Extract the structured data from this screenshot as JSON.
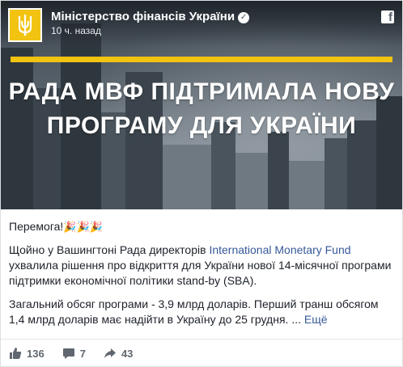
{
  "post": {
    "page_name": "Міністерство фінансів України",
    "timestamp": "10 ч. назад",
    "image_headline_line1": "РАДА МВФ ПІДТРИМАЛА НОВУ",
    "image_headline_line2": "ПРОГРАМУ ДЛЯ УКРАЇНИ",
    "greeting": "Перемога!",
    "greeting_emojis": "🎉🎉🎉",
    "para1_before": "Щойно у Вашингтоні Рада директорів ",
    "para1_link": "International Monetary Fund",
    "para1_after": " ухвалила рішення про відкриття для України нової 14-місячної програми підтримки економічної політики stand-by (SBA).",
    "para2": "Загальний обсяг програми - 3,9 млрд доларів. Перший транш обсягом 1,4 млрд доларів має надійти в Україну до 25 грудня. ... ",
    "see_more": "Ещё"
  },
  "actions": {
    "likes": "136",
    "comments": "7",
    "shares": "43"
  },
  "colors": {
    "brand_yellow": "#f2c311",
    "link_blue": "#365899"
  },
  "icons": [
    "ministry-logo",
    "verified-badge-icon",
    "facebook-icon",
    "like-icon",
    "comment-icon",
    "share-icon"
  ]
}
